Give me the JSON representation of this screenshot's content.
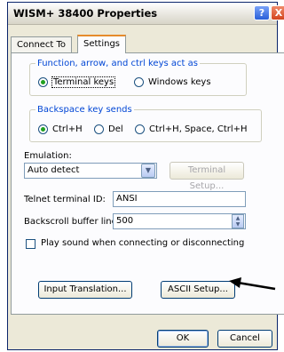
{
  "window": {
    "title": "WISM+ 38400 Properties",
    "help_icon": "?",
    "close_icon": "X"
  },
  "tabs": [
    {
      "label": "Connect To"
    },
    {
      "label": "Settings"
    }
  ],
  "function_keys": {
    "legend": "Function, arrow, and ctrl keys act as",
    "options": [
      "Terminal keys",
      "Windows keys"
    ],
    "selected": "Terminal keys"
  },
  "backspace": {
    "legend": "Backspace key sends",
    "options": [
      "Ctrl+H",
      "Del",
      "Ctrl+H, Space, Ctrl+H"
    ],
    "selected": "Ctrl+H"
  },
  "emulation": {
    "label": "Emulation:",
    "value": "Auto detect",
    "dropdown_icon": "chevron-down-icon",
    "setup_button": "Terminal Setup..."
  },
  "telnet": {
    "label": "Telnet terminal ID:",
    "value": "ANSI"
  },
  "backscroll": {
    "label": "Backscroll buffer lines:",
    "value": "500"
  },
  "play_sound": {
    "label": "Play sound when connecting or disconnecting",
    "checked": false
  },
  "buttons": {
    "input_translation": "Input Translation...",
    "ascii_setup": "ASCII Setup...",
    "ok": "OK",
    "cancel": "Cancel"
  },
  "colors": {
    "accent": "#0046d5",
    "tab_highlight": "#e68b2c",
    "dialog_bg": "#ece9d8"
  }
}
